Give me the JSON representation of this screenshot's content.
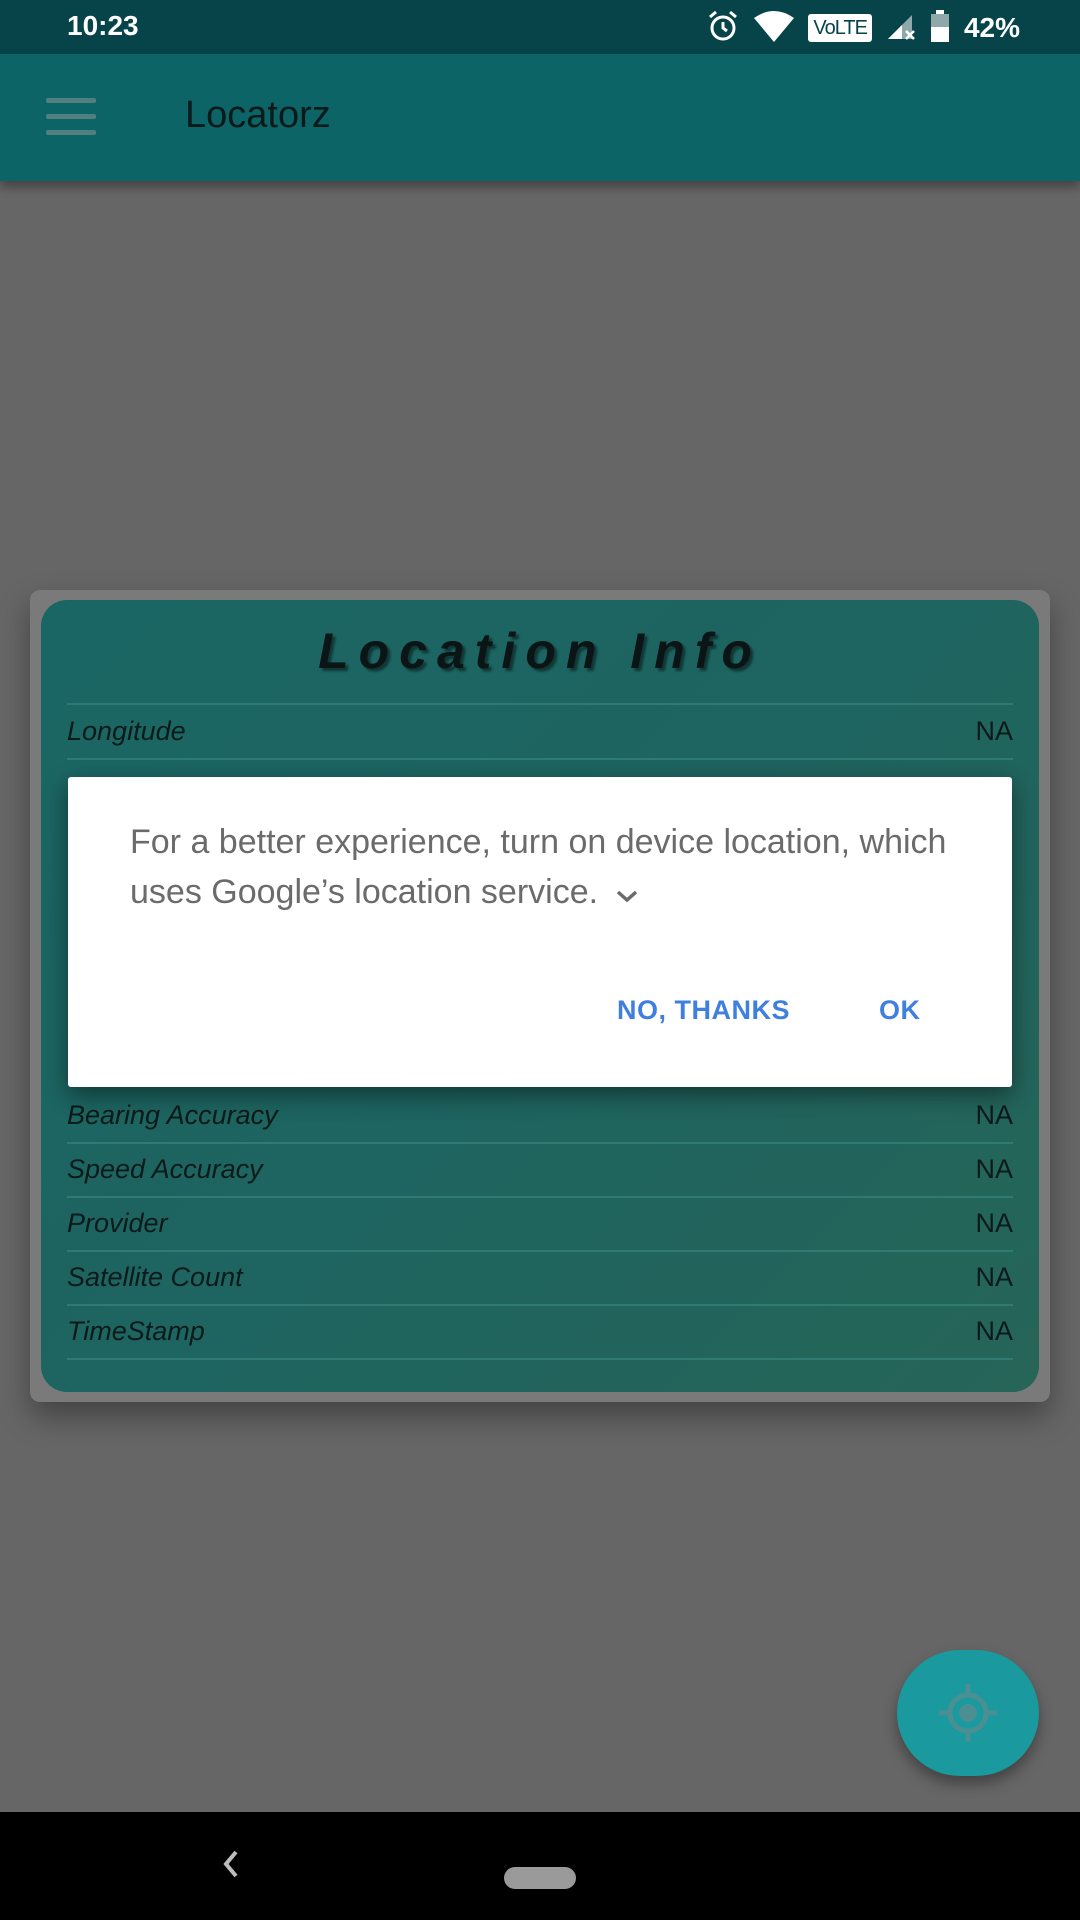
{
  "status_bar": {
    "time": "10:23",
    "network_badge": "VoLTE",
    "battery": "42%"
  },
  "app_bar": {
    "title": "Locatorz"
  },
  "card": {
    "title": "Location Info",
    "rows": [
      {
        "label": "Longitude",
        "value": "NA"
      },
      {
        "label": "Bearing Accuracy",
        "value": "NA"
      },
      {
        "label": "Speed Accuracy",
        "value": "NA"
      },
      {
        "label": "Provider",
        "value": "NA"
      },
      {
        "label": "Satellite Count",
        "value": "NA"
      },
      {
        "label": "TimeStamp",
        "value": "NA"
      }
    ]
  },
  "dialog": {
    "message": "For a better experience, turn on device location, which uses Google’s location service.",
    "no_label": "NO, THANKS",
    "ok_label": "OK"
  },
  "icons": {
    "menu": "menu-icon",
    "fab": "my-location-icon",
    "expand": "chevron-down-icon"
  },
  "colors": {
    "app_bar": "#0d6466",
    "status_bar": "#06444a",
    "card": "#1e6460",
    "dialog_button": "#3f7fe0",
    "fab": "#1a9a9e"
  }
}
